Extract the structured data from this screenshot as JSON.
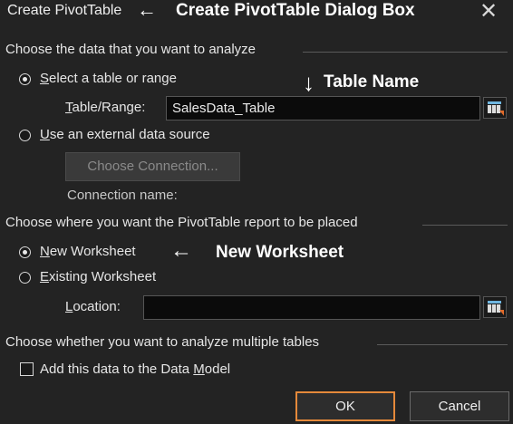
{
  "dialog": {
    "title": "Create PivotTable",
    "close_glyph": "✕"
  },
  "annotations": {
    "title_arrow": "←",
    "title_note": "Create PivotTable Dialog Box",
    "table_arrow": "↓",
    "table_note": "Table Name",
    "worksheet_arrow": "←",
    "worksheet_note": "New Worksheet"
  },
  "data_section": {
    "heading": "Choose the data that you want to analyze",
    "select_table": {
      "label_first": "S",
      "label_rest": "elect a table or range",
      "selected": true
    },
    "table_range": {
      "label_first": "T",
      "label_rest": "able/Range:",
      "value": "SalesData_Table"
    },
    "external": {
      "label_first": "U",
      "label_rest": "se an external data source",
      "selected": false
    },
    "choose_connection": "Choose Connection...",
    "connection_name": "Connection name:"
  },
  "placement_section": {
    "heading": "Choose where you want the PivotTable report to be placed",
    "new_worksheet": {
      "label_first": "N",
      "label_rest": "ew Worksheet",
      "selected": true
    },
    "existing_worksheet": {
      "label_first": "E",
      "label_rest": "xisting Worksheet",
      "selected": false
    },
    "location": {
      "label_first": "L",
      "label_rest": "ocation:",
      "value": ""
    }
  },
  "multiple_section": {
    "heading": "Choose whether you want to analyze multiple tables",
    "add_to_model": {
      "label_before": "Add this data to the Data ",
      "label_underlined": "M",
      "label_after": "odel",
      "checked": false
    }
  },
  "buttons": {
    "ok": "OK",
    "cancel": "Cancel"
  },
  "colors": {
    "background": "#232323",
    "ok_border": "#e5893a",
    "field": "#0b0b0b"
  }
}
